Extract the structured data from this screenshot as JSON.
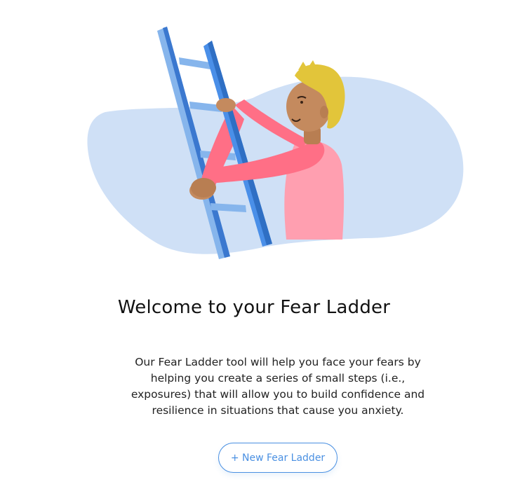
{
  "onboarding": {
    "title": "Welcome to your Fear Ladder",
    "description": "Our Fear Ladder tool will help you face your fears by helping you create a series of small steps (i.e., exposures) that will allow you to build confidence and resilience in situations that cause you anxiety.",
    "new_button_label": "+ New Fear Ladder"
  },
  "colors": {
    "accent": "#4a90e2",
    "blob": "#cfe0f6",
    "ladder_light": "#7fb0ea",
    "ladder_dark": "#2f6fc4",
    "shirt": "#ff6f86",
    "hair": "#e2c53a",
    "skin": "#c48a5e"
  },
  "illustration": {
    "subject": "person-climbing-ladder"
  }
}
